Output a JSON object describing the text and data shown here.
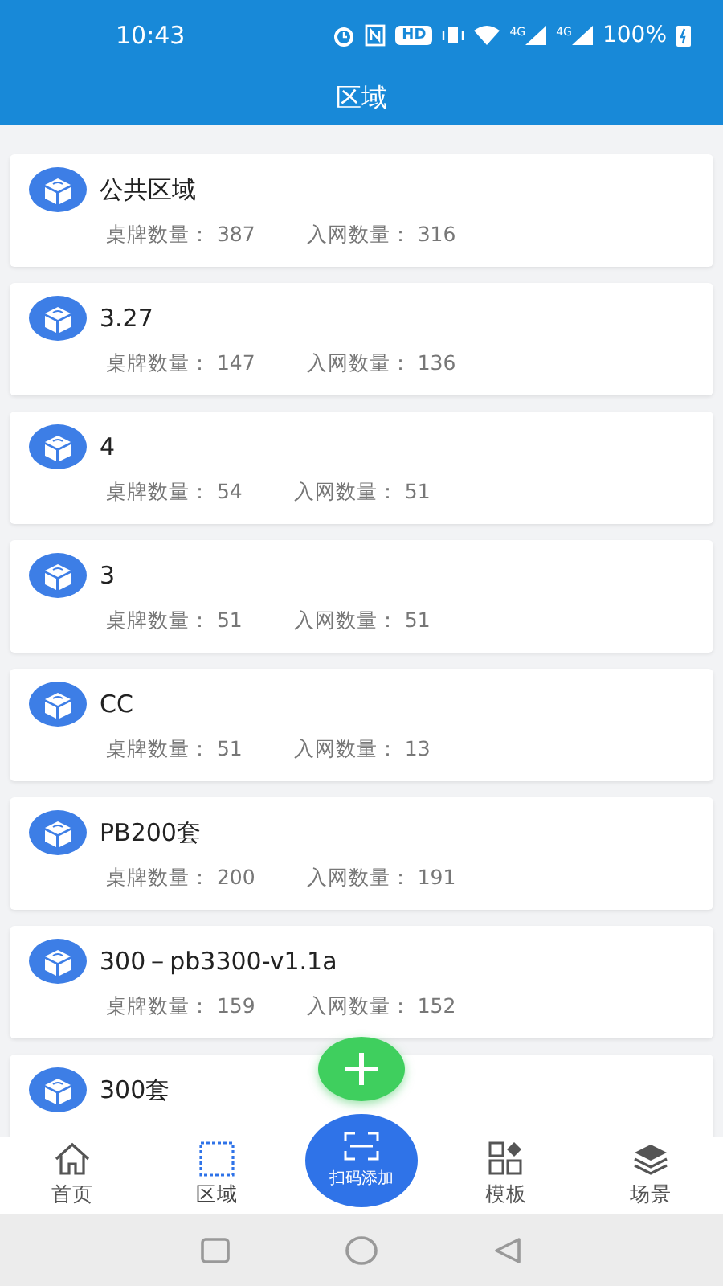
{
  "status_bar": {
    "time": "10:43",
    "hd": "HD",
    "networks": [
      "4G",
      "4G"
    ],
    "battery": "100%"
  },
  "header": {
    "title": "区域"
  },
  "areas": [
    {
      "name": "公共区域",
      "stats": [
        {
          "label": "桌牌数量：",
          "value": "387"
        },
        {
          "label": "入网数量：",
          "value": "316"
        }
      ]
    },
    {
      "name": "3.27",
      "stats": [
        {
          "label": "桌牌数量：",
          "value": "147"
        },
        {
          "label": "入网数量：",
          "value": "136"
        }
      ]
    },
    {
      "name": "4",
      "stats": [
        {
          "label": "桌牌数量：",
          "value": "54"
        },
        {
          "label": "入网数量：",
          "value": "51"
        }
      ]
    },
    {
      "name": "3",
      "stats": [
        {
          "label": "桌牌数量：",
          "value": "51"
        },
        {
          "label": "入网数量：",
          "value": "51"
        }
      ]
    },
    {
      "name": "CC",
      "stats": [
        {
          "label": "桌牌数量：",
          "value": "51"
        },
        {
          "label": "入网数量：",
          "value": "13"
        }
      ]
    },
    {
      "name": "PB200套",
      "stats": [
        {
          "label": "桌牌数量：",
          "value": "200"
        },
        {
          "label": "入网数量：",
          "value": "191"
        }
      ]
    },
    {
      "name": "300－pb3300-v1.1a",
      "stats": [
        {
          "label": "桌牌数量：",
          "value": "159"
        },
        {
          "label": "入网数量：",
          "value": "152"
        }
      ]
    },
    {
      "name": "300套"
    }
  ],
  "tabs": [
    {
      "kind": "home",
      "label": "首页",
      "selected": false
    },
    {
      "kind": "area",
      "label": "区域",
      "selected": true
    },
    {
      "kind": "scan",
      "label": "扫码添加",
      "selected": false
    },
    {
      "kind": "template",
      "label": "模板",
      "selected": false
    },
    {
      "kind": "scene",
      "label": "场景",
      "selected": false
    }
  ]
}
